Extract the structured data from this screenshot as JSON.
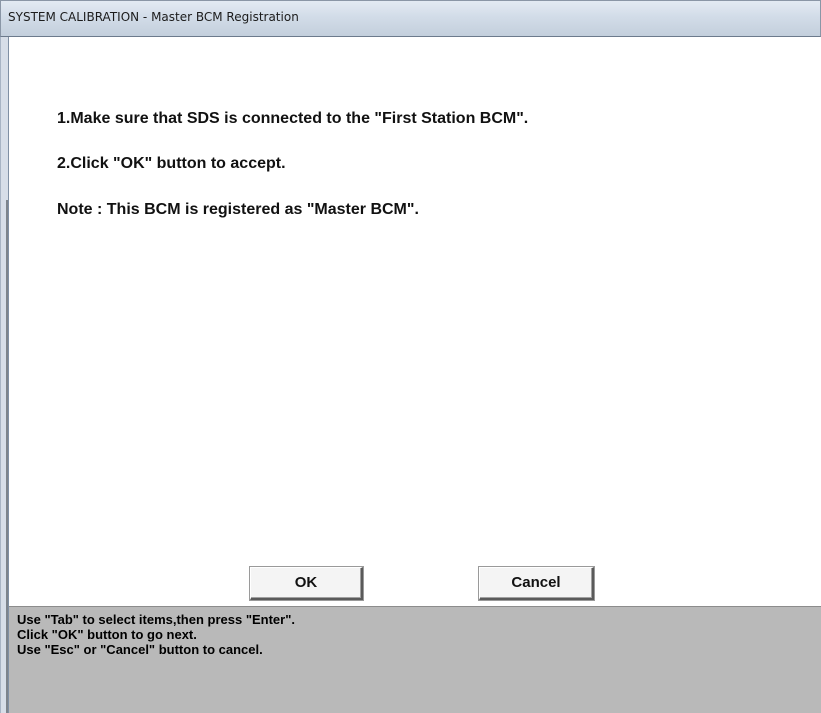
{
  "window": {
    "title": "SYSTEM CALIBRATION - Master BCM Registration"
  },
  "instructions": {
    "step1": "1.Make sure that SDS is connected to the \"First Station BCM\".",
    "step2": "2.Click \"OK\" button to accept.",
    "note": "Note : This BCM is registered as \"Master BCM\"."
  },
  "buttons": {
    "ok_label": "OK",
    "cancel_label": "Cancel"
  },
  "status": {
    "line1": "Use \"Tab\" to select items,then press \"Enter\".",
    "line2": "Click \"OK\" button to go next.",
    "line3": "Use \"Esc\" or \"Cancel\" button to cancel."
  },
  "colors": {
    "status_background": "#b9b9b9",
    "client_background": "#ffffff",
    "button_face": "#f4f4f4"
  }
}
